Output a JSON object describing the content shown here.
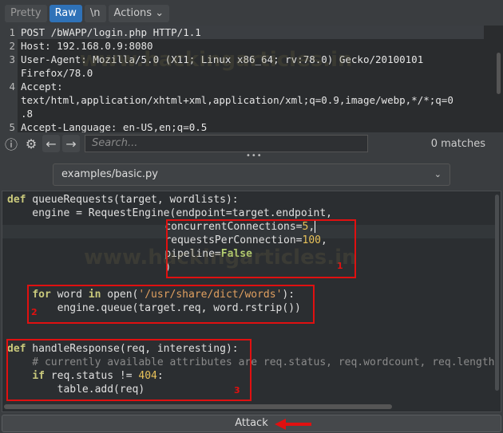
{
  "tabs": {
    "pretty": "Pretty",
    "raw": "Raw",
    "newline": "\\n",
    "actions": "Actions"
  },
  "request": {
    "lines": [
      {
        "n": "1",
        "t": "POST /bWAPP/login.php HTTP/1.1"
      },
      {
        "n": "2",
        "t": "Host: 192.168.0.9:8080"
      },
      {
        "n": "3",
        "t": "User-Agent: Mozilla/5.0 (X11; Linux x86_64; rv:78.0) Gecko/20100101"
      },
      {
        "n": "",
        "t": "Firefox/78.0"
      },
      {
        "n": "4",
        "t": "Accept:"
      },
      {
        "n": "",
        "t": "text/html,application/xhtml+xml,application/xml;q=0.9,image/webp,*/*;q=0"
      },
      {
        "n": "",
        "t": ".8"
      },
      {
        "n": "5",
        "t": "Accept-Language: en-US,en;q=0.5"
      }
    ]
  },
  "search": {
    "placeholder": "Search...",
    "matches": "0 matches"
  },
  "script_file": "examples/basic.py",
  "code": {
    "l1a": "def",
    "l1b": " queueRequests(target, wordlists):",
    "l2": "    engine = RequestEngine(endpoint=target.endpoint,",
    "l3a": "                           concurrentConnections=",
    "l3b": "5",
    ",": ",",
    "l4a": "                           requestsPerConnection=",
    "l4b": "100",
    "l4c": ",",
    "l5a": "                           pipeline=",
    "l5b": "False",
    "l6": "                           )",
    "l8a": "    ",
    "l8b": "for",
    "l8c": " word ",
    "l8d": "in",
    "l8e": " open(",
    "l8f": "'/usr/share/dict/words'",
    "l8g": "):",
    "l9": "        engine.queue(target.req, word.rstrip())",
    "l12a": "def",
    "l12b": " handleResponse(req, interesting):",
    "l13": "    # currently available attributes are req.status, req.wordcount, req.length",
    "l14a": "    ",
    "l14b": "if",
    "l14c": " req.status != ",
    "l14d": "404",
    "l14e": ":",
    "l15": "        table.add(req)"
  },
  "annotations": [
    "1",
    "2",
    "3"
  ],
  "attack_label": "Attack",
  "watermark": "www.hackingarticles.in",
  "colors": {
    "accent": "#2f72b8",
    "annotation": "#e01010"
  }
}
